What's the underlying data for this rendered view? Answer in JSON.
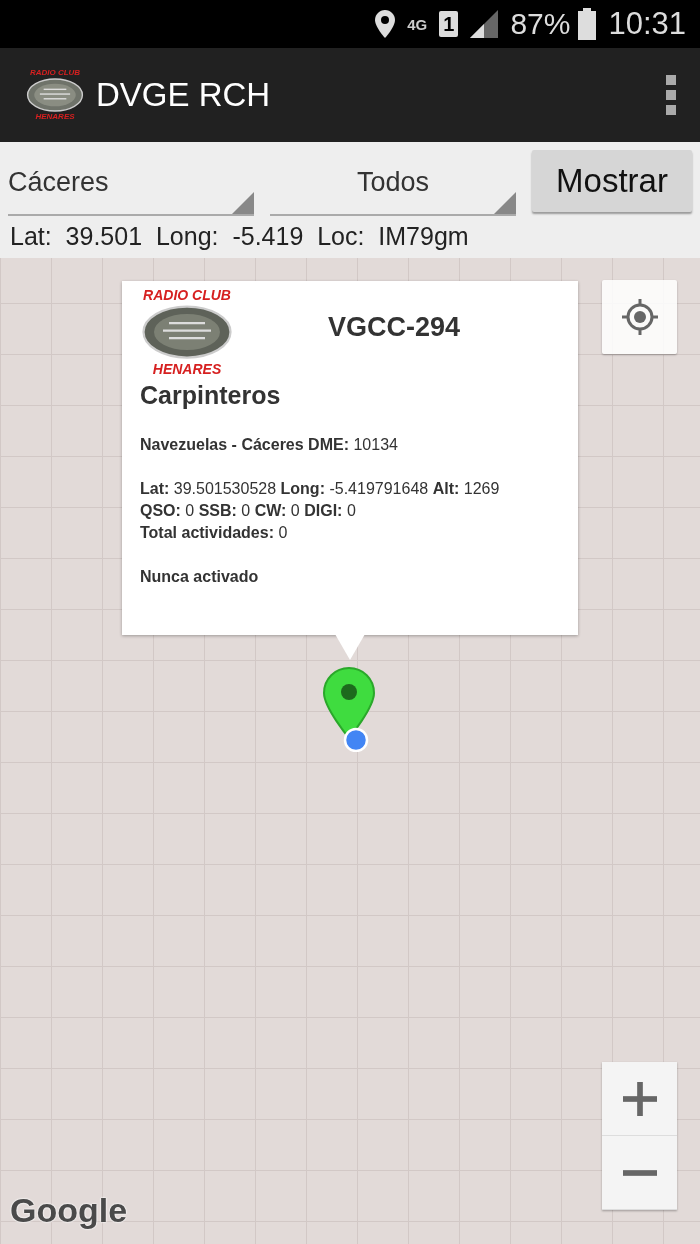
{
  "status_bar": {
    "network": "4G",
    "sim": "1",
    "battery": "87%",
    "time": "10:31"
  },
  "app_bar": {
    "logo_top": "RADIO CLUB",
    "logo_bottom": "HENARES",
    "title": "DVGE RCH"
  },
  "filters": {
    "province": "Cáceres",
    "type": "Todos",
    "button": "Mostrar"
  },
  "position": "Lat:  39.501  Long:  -5.419  Loc:  IM79gm",
  "info_window": {
    "logo_top": "RADIO CLUB",
    "logo_bottom": "HENARES",
    "code": "VGCC-294",
    "name": "Carpinteros",
    "place": "**Navezuelas - Cáceres DME:** 10134",
    "details": [
      "**Lat:** 39.501530528 **Long:** -5.419791648 **Alt:** 1269",
      "**QSO:** 0 **SSB:** 0 **CW:** 0 **DIGI:** 0",
      "**Total actividades:** 0"
    ],
    "status": "Nunca activado"
  },
  "map": {
    "attribution": "Google"
  }
}
